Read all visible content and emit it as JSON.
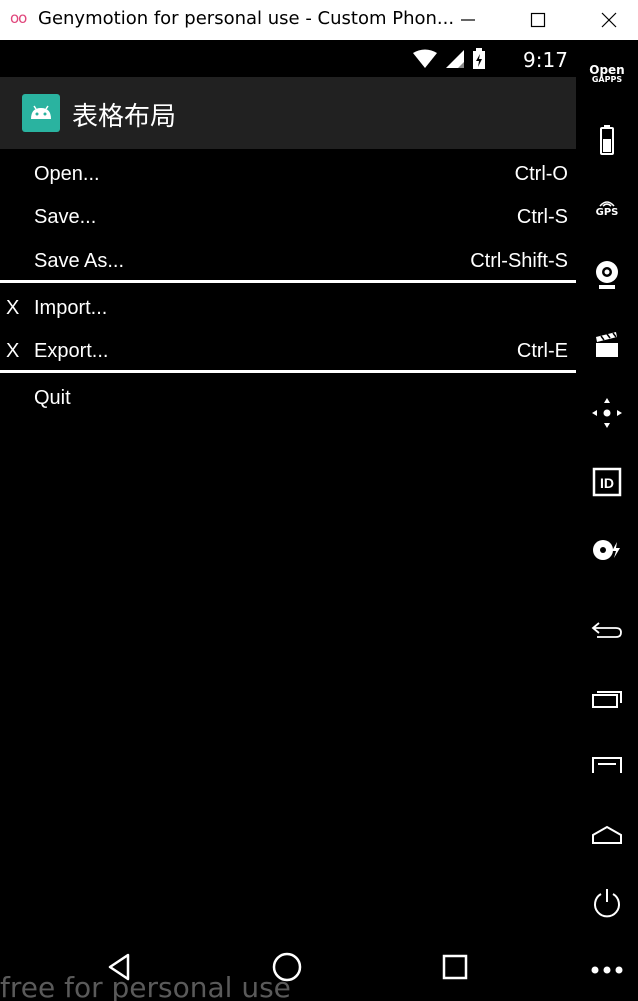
{
  "window": {
    "title": "Genymotion for personal use - Custom Phon...",
    "logo": "oo"
  },
  "status_bar": {
    "time": "9:17"
  },
  "action_bar": {
    "title": "表格布局"
  },
  "menu": {
    "items": [
      {
        "check": "",
        "label": "Open...",
        "shortcut": "Ctrl-O"
      },
      {
        "check": "",
        "label": "Save...",
        "shortcut": "Ctrl-S"
      },
      {
        "check": "",
        "label": "Save As...",
        "shortcut": "Ctrl-Shift-S"
      },
      {
        "check": "X",
        "label": "Import...",
        "shortcut": ""
      },
      {
        "check": "X",
        "label": "Export...",
        "shortcut": "Ctrl-E"
      },
      {
        "check": "",
        "label": "Quit",
        "shortcut": ""
      }
    ]
  },
  "sidebar": {
    "open_gapps_line1": "Open",
    "open_gapps_line2": "GAPPS",
    "gps_label": "GPS",
    "id_label": "ID"
  },
  "watermark": "free for personal use",
  "colors": {
    "window_bar": "#ffffff",
    "logo": "#e0457b",
    "action_bar": "#212121",
    "app_icon": "#2ab3a0",
    "watermark": "#5a5a5a"
  }
}
